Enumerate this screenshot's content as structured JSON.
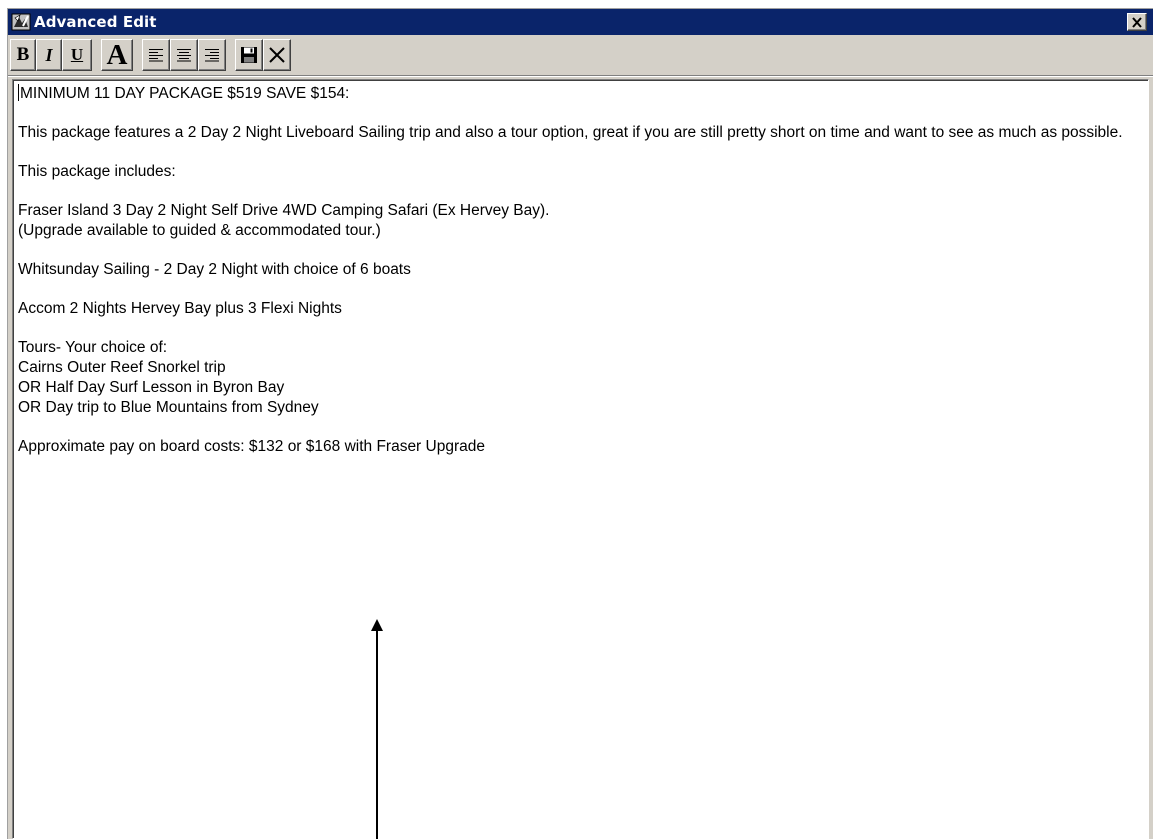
{
  "window": {
    "title": "Advanced Edit",
    "title_bg": "#0a246a",
    "icons": {
      "app": "app-icon",
      "close": "close-icon"
    }
  },
  "toolbar": {
    "bold_label": "B",
    "italic_label": "I",
    "underline_label": "U",
    "font_label": "A",
    "align_left_icon": "align-left-icon",
    "align_center_icon": "align-center-icon",
    "align_right_icon": "align-right-icon",
    "save_icon": "save-icon",
    "cancel_icon": "cancel-icon"
  },
  "editor": {
    "lines": [
      "MINIMUM 11 DAY PACKAGE $519 SAVE $154:",
      "",
      "This package features a 2 Day 2 Night Liveboard Sailing trip and also a tour option, great if you are still pretty short on time and want to see as much as possible.",
      "",
      "This package includes:",
      "",
      "Fraser Island 3 Day 2 Night Self Drive 4WD Camping Safari (Ex Hervey Bay).",
      "(Upgrade available to guided & accommodated tour.)",
      "",
      "Whitsunday Sailing - 2 Day 2 Night with choice of 6 boats",
      "",
      "Accom 2 Nights Hervey Bay plus 3 Flexi Nights",
      "",
      "Tours- Your choice of:",
      "Cairns Outer Reef Snorkel trip",
      "OR Half Day Surf Lesson in Byron Bay",
      "OR Day trip to Blue Mountains from Sydney",
      "",
      "Approximate pay on board costs: $132 or $168 with Fraser Upgrade"
    ]
  },
  "annotation": {
    "icon": "arrow-up-icon"
  }
}
